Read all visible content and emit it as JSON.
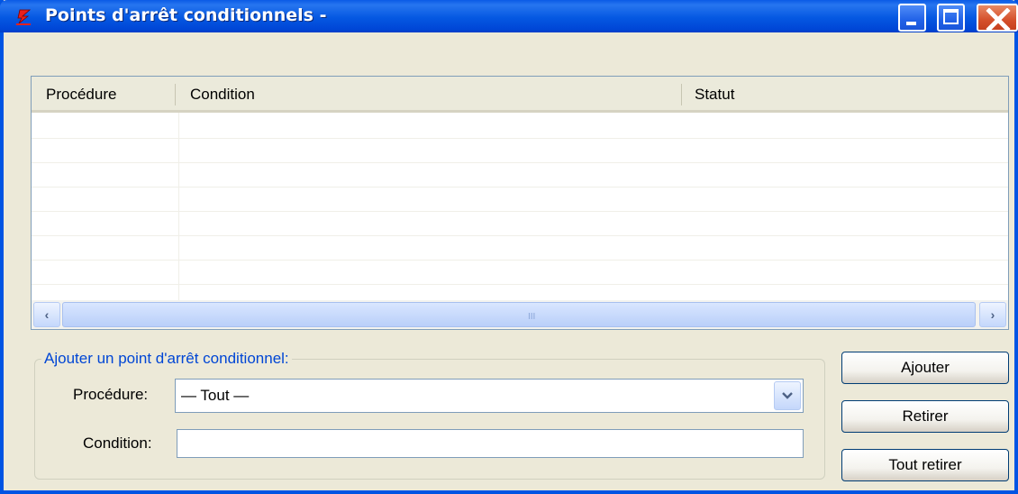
{
  "window": {
    "title": "Points d'arrêt conditionnels -",
    "icon": "app-icon",
    "controls": [
      "minimize-icon",
      "maximize-icon",
      "close-icon"
    ]
  },
  "list": {
    "columns": [
      {
        "label": "Procédure"
      },
      {
        "label": "Condition"
      },
      {
        "label": "Statut"
      }
    ],
    "rows": [],
    "scrollbar": {
      "left_icon": "chevron-left-icon",
      "right_icon": "chevron-right-icon",
      "grip": "III"
    }
  },
  "form": {
    "group_label": "Ajouter un point d'arrêt conditionnel:",
    "procedure_label": "Procédure:",
    "procedure_value": "— Tout —",
    "condition_label": "Condition:",
    "condition_value": ""
  },
  "buttons": {
    "add": "Ajouter",
    "remove": "Retirer",
    "remove_all": "Tout retirer"
  }
}
